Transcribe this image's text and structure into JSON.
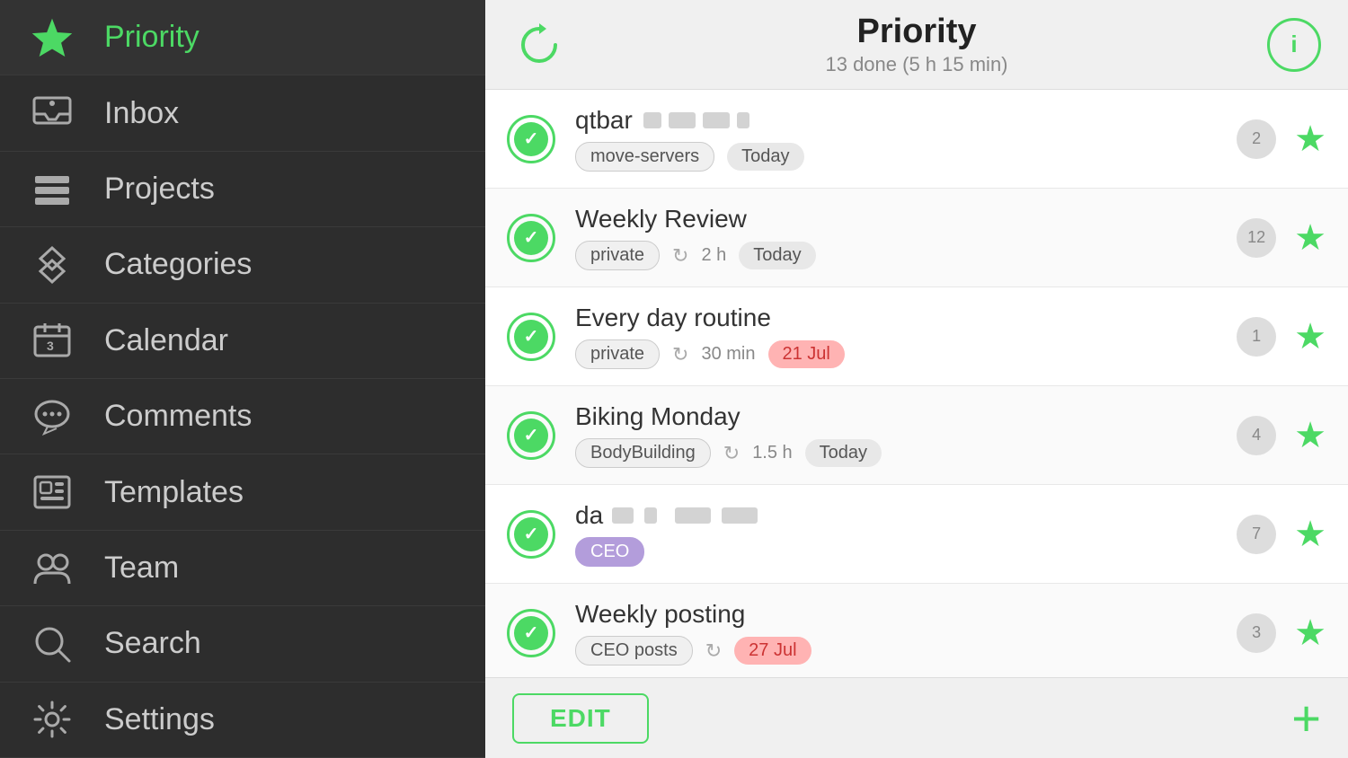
{
  "sidebar": {
    "items": [
      {
        "id": "priority",
        "label": "Priority",
        "active": true
      },
      {
        "id": "inbox",
        "label": "Inbox",
        "active": false
      },
      {
        "id": "projects",
        "label": "Projects",
        "active": false
      },
      {
        "id": "categories",
        "label": "Categories",
        "active": false
      },
      {
        "id": "calendar",
        "label": "Calendar",
        "active": false
      },
      {
        "id": "comments",
        "label": "Comments",
        "active": false
      },
      {
        "id": "templates",
        "label": "Templates",
        "active": false
      },
      {
        "id": "team",
        "label": "Team",
        "active": false
      },
      {
        "id": "search",
        "label": "Search",
        "active": false
      },
      {
        "id": "settings",
        "label": "Settings",
        "active": false
      }
    ]
  },
  "header": {
    "title": "Priority",
    "subtitle": "13 done (5 h 15 min)",
    "refresh_label": "refresh",
    "info_label": "i"
  },
  "tasks": [
    {
      "id": 1,
      "title": "qtbar",
      "tags": [
        "move-servers"
      ],
      "date": "Today",
      "date_overdue": false,
      "comments": 2,
      "starred": true,
      "has_blur": true,
      "duration": "",
      "has_recur": false
    },
    {
      "id": 2,
      "title": "Weekly Review",
      "tags": [
        "private"
      ],
      "date": "Today",
      "date_overdue": false,
      "comments": 12,
      "starred": true,
      "has_blur": false,
      "duration": "2 h",
      "has_recur": true
    },
    {
      "id": 3,
      "title": "Every day routine",
      "tags": [
        "private"
      ],
      "date": "21 Jul",
      "date_overdue": true,
      "comments": 1,
      "starred": true,
      "has_blur": false,
      "duration": "30 min",
      "has_recur": true
    },
    {
      "id": 4,
      "title": "Biking Monday",
      "tags": [
        "BodyBuilding"
      ],
      "date": "Today",
      "date_overdue": false,
      "comments": 4,
      "starred": true,
      "has_blur": false,
      "duration": "1.5 h",
      "has_recur": true
    },
    {
      "id": 5,
      "title": "daily mailing",
      "tags_special": [
        "CEO"
      ],
      "date": "",
      "date_overdue": false,
      "comments": 7,
      "starred": true,
      "has_blur": true,
      "duration": "",
      "has_recur": false
    },
    {
      "id": 6,
      "title": "Weekly posting",
      "tags": [
        "CEO posts"
      ],
      "date": "27 Jul",
      "date_overdue": true,
      "comments": 3,
      "starred": true,
      "has_blur": false,
      "duration": "",
      "has_recur": true
    }
  ],
  "footer": {
    "edit_label": "EDIT",
    "add_label": "+"
  }
}
